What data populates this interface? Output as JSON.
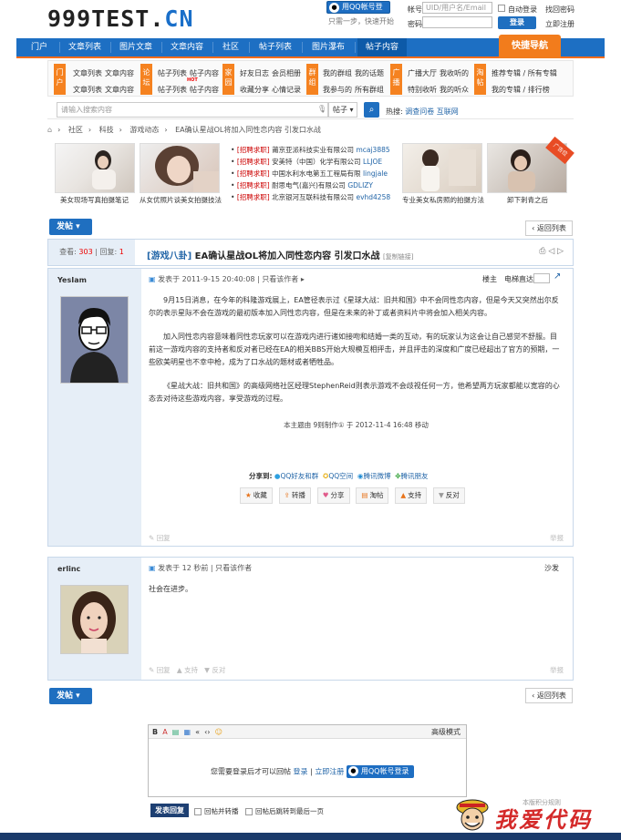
{
  "site": {
    "logo_main": "999TEST.",
    "logo_cn": "CN"
  },
  "login": {
    "qq_button": "用QQ帐号登录",
    "one_step": "只需一步，快速开始",
    "account_label": "帐号",
    "account_placeholder": "UID/用户名/Email",
    "auto_login": "自动登录",
    "forgot_password": "找回密码",
    "password_label": "密码",
    "login_button": "登录",
    "register": "立即注册"
  },
  "nav": {
    "items": [
      "门户",
      "文章列表",
      "图片文章",
      "文章内容",
      "社区",
      "帖子列表",
      "图片瀑布",
      "帖子内容"
    ],
    "quick_nav": "快捷导航"
  },
  "subnav": {
    "tags": [
      "门户",
      "论坛",
      "家园",
      "群组",
      "广播",
      "淘帖"
    ],
    "menu": [
      [
        "文章列表",
        "文章内容",
        "文章列表",
        "文章内容"
      ],
      [
        "帖子列表",
        "帖子内容",
        "帖子列表",
        "帖子内容"
      ],
      [
        "好友日志",
        "会员相册",
        "收藏分享",
        "心情记录"
      ],
      [
        "我的群组",
        "我的话题",
        "我参与的",
        "所有群组"
      ],
      [
        "广播大厅",
        "我收听的",
        "特别收听",
        "我的听众"
      ],
      [
        "推荐专辑 / 所有专辑",
        "我的专辑 / 排行榜"
      ]
    ],
    "hot_badge": "HOT"
  },
  "search": {
    "placeholder": "请输入搜索内容",
    "type": "帖子",
    "hot_label": "热搜:",
    "hot_terms": [
      "调查问卷",
      "互联网"
    ]
  },
  "breadcrumb": [
    "社区",
    "科技",
    "游戏动态",
    "EA确认星战OL将加入同性恋内容 引发口水战"
  ],
  "banner": {
    "left_captions": [
      "美女现场写真拍摄笔记",
      "从女优照片谈美女拍摄技法"
    ],
    "jobs": [
      {
        "tag": "[招聘求职]",
        "company": "莆京亚派科技实业有限公司",
        "user": "mcaj3885"
      },
      {
        "tag": "[招聘求职]",
        "company": "安美特（中国）化学有限公司",
        "user": "LLJOE"
      },
      {
        "tag": "[招聘求职]",
        "company": "中国水利水电第五工程局有限",
        "user": "lingjale"
      },
      {
        "tag": "[招聘求职]",
        "company": "耐思电气(嘉兴)有限公司",
        "user": "GDLIZY"
      },
      {
        "tag": "[招聘求职]",
        "company": "北京银河互联科技有限公司",
        "user": "evhd4258"
      }
    ],
    "right_captions": [
      "专业美女私房照的拍摄方法",
      "卸下刺青之后"
    ],
    "ribbon": "广告位"
  },
  "thread": {
    "post_button": "发帖",
    "back_button": "返回列表",
    "views_label": "查看:",
    "views": "303",
    "replies_label": "回复:",
    "replies": "1",
    "category": "[游戏八卦]",
    "title": "EA确认星战OL将加入同性恋内容 引发口水战",
    "copy_link": "[复制链接]"
  },
  "post1": {
    "author": "YesIam",
    "posted": "发表于 2011-9-15 20:40:08",
    "only_author": "只看该作者",
    "floor": "楼主",
    "jump": "电梯直达",
    "paragraphs": [
      "9月15日消息，在今年的科隆游戏展上，EA管径表示过《星球大战：旧共和国》中不会同性恋内容，但是今天又突然出尔反尔的表示星际不会在游戏的最初版本加入同性恋内容，但是在未来的补丁或者资料片中将会加入相关内容。",
      "加入同性恋内容意味着同性恋玩家可以在游戏内进行诸如接吻和结婚一类的互动，有的玩家认为这会让自己感觉不舒服。目前这一游戏内容的支持者和反对者已经在EA的相关BBS开始大规模互相抨击，并且抨击的深度和广度已经超出了官方的预期，一些欧美明星也不幸中枪，成为了口水战的题材或者牺牲品。",
      "《星战大战：旧共和国》的高级网络社区经理StephenReid则表示游戏不会歧视任何一方，他希望两方玩家都能以宽容的心态去对待这些游戏内容，享受游戏的过程。"
    ],
    "edited": "本主题由 9则制作① 于 2012-11-4 16:48 移动",
    "share_label": "分享到:",
    "share": [
      "QQ好友和群",
      "QQ空间",
      "腾讯微博",
      "腾讯朋友"
    ],
    "actions": [
      "收藏",
      "转播",
      "分享",
      "淘帖",
      "支持",
      "反对"
    ],
    "reply": "回复",
    "report": "举报"
  },
  "post2": {
    "author": "erlinc",
    "posted": "发表于 12 秒前",
    "only_author": "只看该作者",
    "floor": "沙发",
    "content": "社会在进步。",
    "footer": [
      "回复",
      "支持",
      "反对"
    ],
    "report": "举报"
  },
  "reply": {
    "post_button": "发帖",
    "back_button": "返回列表",
    "tools": [
      "B",
      "A",
      "▤",
      "▦",
      "«",
      "‹›",
      "☺"
    ],
    "mode": "高级模式",
    "need_login": "您需要登录后才可以回帖",
    "login": "登录",
    "register": "立即注册",
    "qq_button": "用QQ帐号登录",
    "submit": "发表回复",
    "opt1": "回帖并转播",
    "opt2": "回帖后跳转到最后一页",
    "rules": "本版积分规则"
  },
  "watermark": "我爱代码",
  "colors": {
    "brand_blue": "#1d6fc3",
    "accent_orange": "#f27c1c",
    "side_bg": "#e6eef7"
  }
}
